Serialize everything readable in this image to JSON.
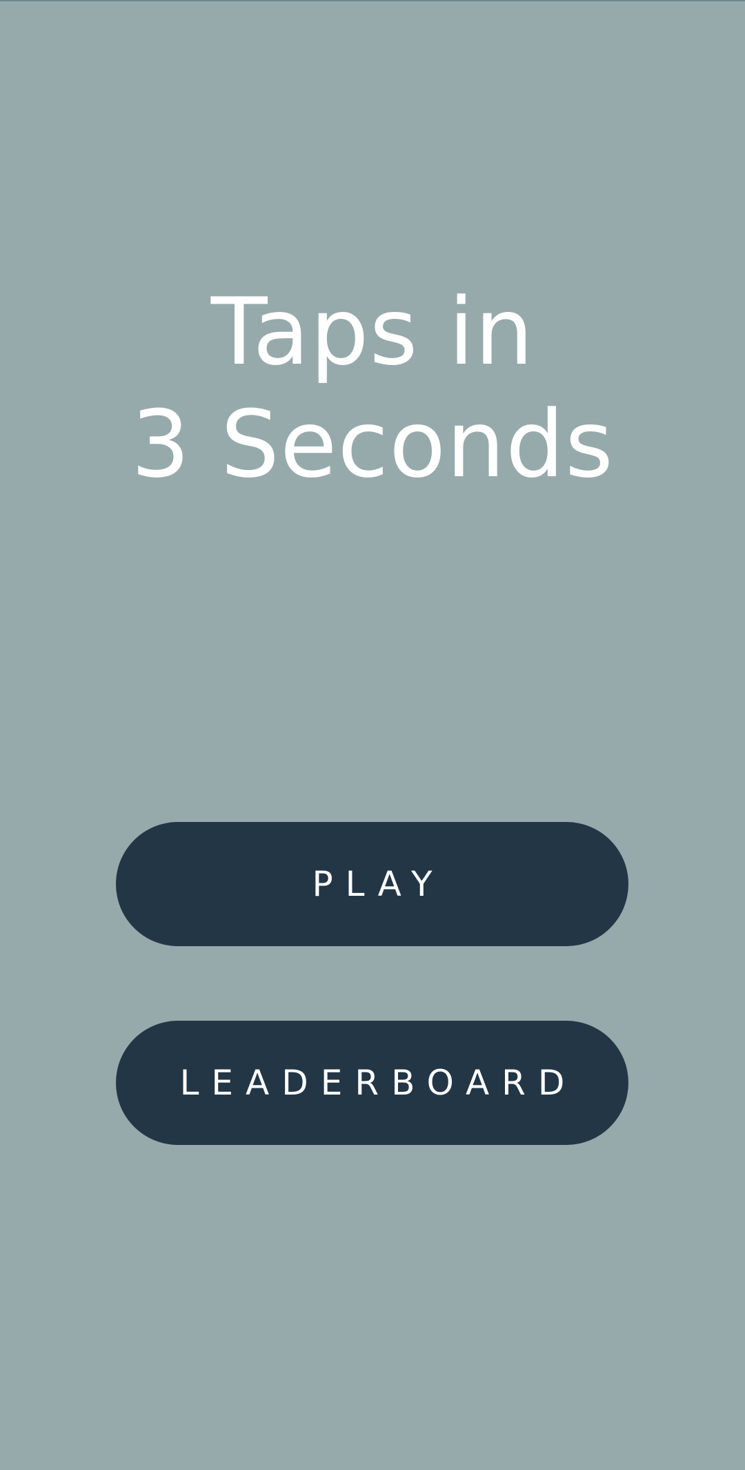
{
  "title": {
    "line1": "Taps in",
    "line2": "3 Seconds"
  },
  "buttons": {
    "play_label": "PLAY",
    "leaderboard_label": "LEADERBOARD"
  },
  "colors": {
    "background": "#97aaab",
    "button": "#223646",
    "text": "#ffffff"
  }
}
